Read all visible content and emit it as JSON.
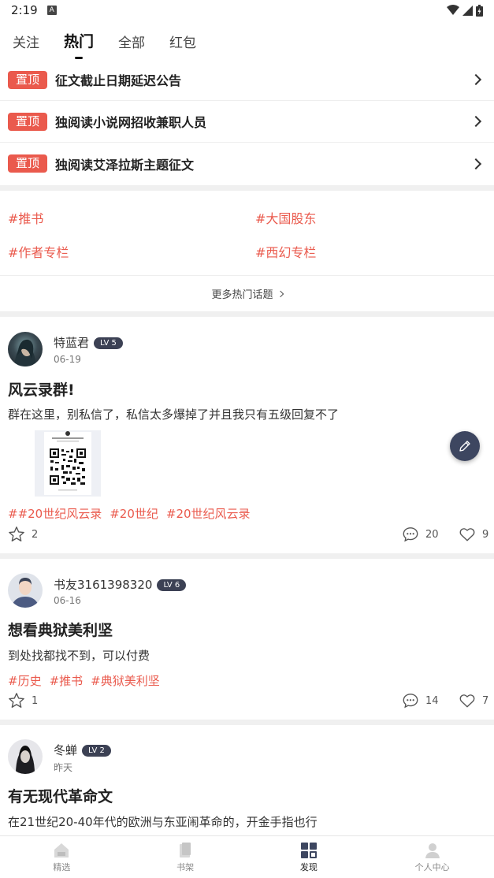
{
  "status": {
    "time": "2:19",
    "notif_letter": "A"
  },
  "tabs": [
    {
      "label": "关注"
    },
    {
      "label": "热门",
      "active": true
    },
    {
      "label": "全部"
    },
    {
      "label": "红包"
    }
  ],
  "pinned": [
    {
      "badge": "置顶",
      "title": "征文截止日期延迟公告"
    },
    {
      "badge": "置顶",
      "title": "独阅读小说网招收兼职人员"
    },
    {
      "badge": "置顶",
      "title": "独阅读艾泽拉斯主题征文"
    }
  ],
  "topics": [
    "#推书",
    "#大国股东",
    "#作者专栏",
    "#西幻专栏"
  ],
  "more_topics": "更多热门话题",
  "posts": [
    {
      "user": "特蓝君",
      "level": "LV 5",
      "date": "06-19",
      "title": "风云录群!",
      "body": "群在这里，别私信了，私信太多爆掉了并且我只有五级回复不了",
      "tags": [
        "##20世纪风云录",
        "#20世纪",
        "#20世纪风云录"
      ],
      "stars": "2",
      "comments": "20",
      "likes": "9"
    },
    {
      "user": "书友3161398320",
      "level": "LV 6",
      "date": "06-16",
      "title": "想看典狱美利坚",
      "body": "到处找都找不到，可以付费",
      "tags": [
        "#历史",
        "#推书",
        "#典狱美利坚"
      ],
      "stars": "1",
      "comments": "14",
      "likes": "7"
    },
    {
      "user": "冬蝉",
      "level": "LV 2",
      "date": "昨天",
      "title": "有无现代革命文",
      "body": "在21世纪20-40年代的欧洲与东亚闹革命的，开金手指也行"
    }
  ],
  "bottom_nav": [
    {
      "label": "精选",
      "icon": "home-icon"
    },
    {
      "label": "书架",
      "icon": "bookshelf-icon"
    },
    {
      "label": "发现",
      "icon": "discover-icon",
      "active": true
    },
    {
      "label": "个人中心",
      "icon": "profile-icon"
    }
  ],
  "colors": {
    "accent": "#ea5a4d",
    "badge_dark": "#3c4154"
  }
}
